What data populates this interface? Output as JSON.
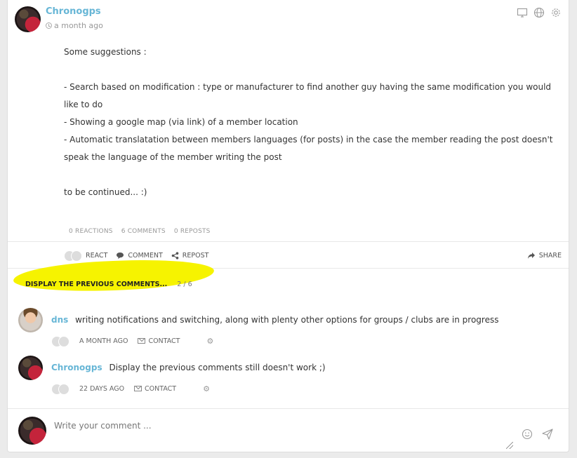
{
  "post": {
    "author": "Chronogps",
    "time": "a month ago",
    "paragraphs": [
      "Some suggestions :",
      "",
      "- Search based on modification : type or manufacturer to find another guy having the same modification you would like to do",
      "- Showing a google map (via link) of a member location",
      "- Automatic translatation between members languages (for posts) in the case the member reading the post doesn't speak the language of the member writing the post",
      "",
      "to be continued... :)"
    ],
    "stats": {
      "reactions": "0 REACTIONS",
      "comments": "6 COMMENTS",
      "reposts": "0 REPOSTS"
    },
    "actions": {
      "react": "REACT",
      "comment": "COMMENT",
      "repost": "REPOST",
      "share": "SHARE"
    }
  },
  "comments_section": {
    "previous_label": "DISPLAY THE PREVIOUS COMMENTS...",
    "previous_count": "2 / 6",
    "items": [
      {
        "author": "dns",
        "text": "writing notifications and switching, along with plenty other options for groups / clubs are in progress",
        "time": "A MONTH AGO",
        "contact": "CONTACT"
      },
      {
        "author": "Chronogps",
        "text": "Display the previous comments still doesn't work ;)",
        "time": "22 DAYS AGO",
        "contact": "CONTACT"
      }
    ]
  },
  "compose": {
    "placeholder": "Write your comment ..."
  },
  "colors": {
    "author_link": "#67b6d6",
    "highlight": "#f6f300"
  },
  "icons": [
    "clock-icon",
    "desktop-icon",
    "globe-icon",
    "gear-icon",
    "react-icon",
    "comment-icon",
    "repost-icon",
    "share-icon",
    "envelope-icon",
    "smiley-icon",
    "send-icon"
  ]
}
